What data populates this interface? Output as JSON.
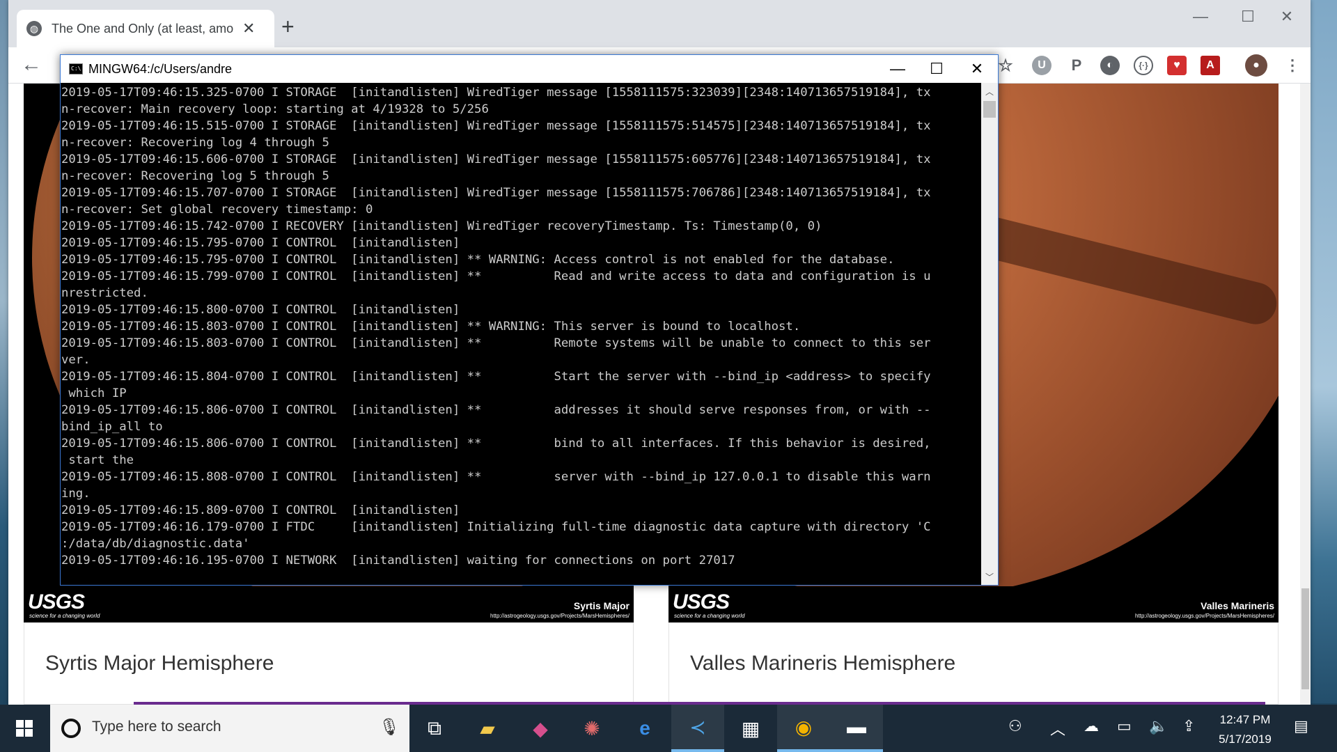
{
  "browser": {
    "tab_title": "The One and Only (at least, among",
    "new_tab_symbol": "+",
    "close_symbol": "✕"
  },
  "terminal": {
    "title": "MINGW64:/c/Users/andre",
    "lines": [
      "2019-05-17T09:46:15.325-0700 I STORAGE  [initandlisten] WiredTiger message [1558111575:323039][2348:140713657519184], tx",
      "n-recover: Main recovery loop: starting at 4/19328 to 5/256",
      "2019-05-17T09:46:15.515-0700 I STORAGE  [initandlisten] WiredTiger message [1558111575:514575][2348:140713657519184], tx",
      "n-recover: Recovering log 4 through 5",
      "2019-05-17T09:46:15.606-0700 I STORAGE  [initandlisten] WiredTiger message [1558111575:605776][2348:140713657519184], tx",
      "n-recover: Recovering log 5 through 5",
      "2019-05-17T09:46:15.707-0700 I STORAGE  [initandlisten] WiredTiger message [1558111575:706786][2348:140713657519184], tx",
      "n-recover: Set global recovery timestamp: 0",
      "2019-05-17T09:46:15.742-0700 I RECOVERY [initandlisten] WiredTiger recoveryTimestamp. Ts: Timestamp(0, 0)",
      "2019-05-17T09:46:15.795-0700 I CONTROL  [initandlisten]",
      "2019-05-17T09:46:15.795-0700 I CONTROL  [initandlisten] ** WARNING: Access control is not enabled for the database.",
      "2019-05-17T09:46:15.799-0700 I CONTROL  [initandlisten] **          Read and write access to data and configuration is u",
      "nrestricted.",
      "2019-05-17T09:46:15.800-0700 I CONTROL  [initandlisten]",
      "2019-05-17T09:46:15.803-0700 I CONTROL  [initandlisten] ** WARNING: This server is bound to localhost.",
      "2019-05-17T09:46:15.803-0700 I CONTROL  [initandlisten] **          Remote systems will be unable to connect to this ser",
      "ver.",
      "2019-05-17T09:46:15.804-0700 I CONTROL  [initandlisten] **          Start the server with --bind_ip <address> to specify",
      " which IP",
      "2019-05-17T09:46:15.806-0700 I CONTROL  [initandlisten] **          addresses it should serve responses from, or with --",
      "bind_ip_all to",
      "2019-05-17T09:46:15.806-0700 I CONTROL  [initandlisten] **          bind to all interfaces. If this behavior is desired,",
      " start the",
      "2019-05-17T09:46:15.808-0700 I CONTROL  [initandlisten] **          server with --bind_ip 127.0.0.1 to disable this warn",
      "ing.",
      "2019-05-17T09:46:15.809-0700 I CONTROL  [initandlisten]",
      "2019-05-17T09:46:16.179-0700 I FTDC     [initandlisten] Initializing full-time diagnostic data capture with directory 'C",
      ":/data/db/diagnostic.data'",
      "2019-05-17T09:46:16.195-0700 I NETWORK  [initandlisten] waiting for connections on port 27017"
    ]
  },
  "cards": [
    {
      "title": "Syrtis Major Hemisphere",
      "logo": "USGS",
      "tagline": "science for a changing world",
      "image_label": "Syrtis Major",
      "image_url": "http://astrogeology.usgs.gov/Projects/MarsHemispheres/"
    },
    {
      "title": "Valles Marineris Hemisphere",
      "logo": "USGS",
      "tagline": "science for a changing world",
      "image_label": "Valles Marineris",
      "image_url": "http://astrogeology.usgs.gov/Projects/MarsHemispheres/"
    }
  ],
  "taskbar": {
    "search_placeholder": "Type here to search",
    "time": "12:47 PM",
    "date": "5/17/2019"
  },
  "icons": [
    "globe-icon",
    "back-arrow-icon",
    "star-icon",
    "profile-avatar-icon",
    "menu-dots-icon",
    "windows-start-icon",
    "microphone-icon",
    "task-view-icon",
    "file-explorer-icon",
    "edge-icon",
    "vscode-icon",
    "store-icon",
    "chrome-icon",
    "terminal-icon",
    "people-icon",
    "chevron-up-icon",
    "onedrive-icon",
    "battery-icon",
    "volume-icon",
    "upload-icon",
    "notifications-icon"
  ]
}
